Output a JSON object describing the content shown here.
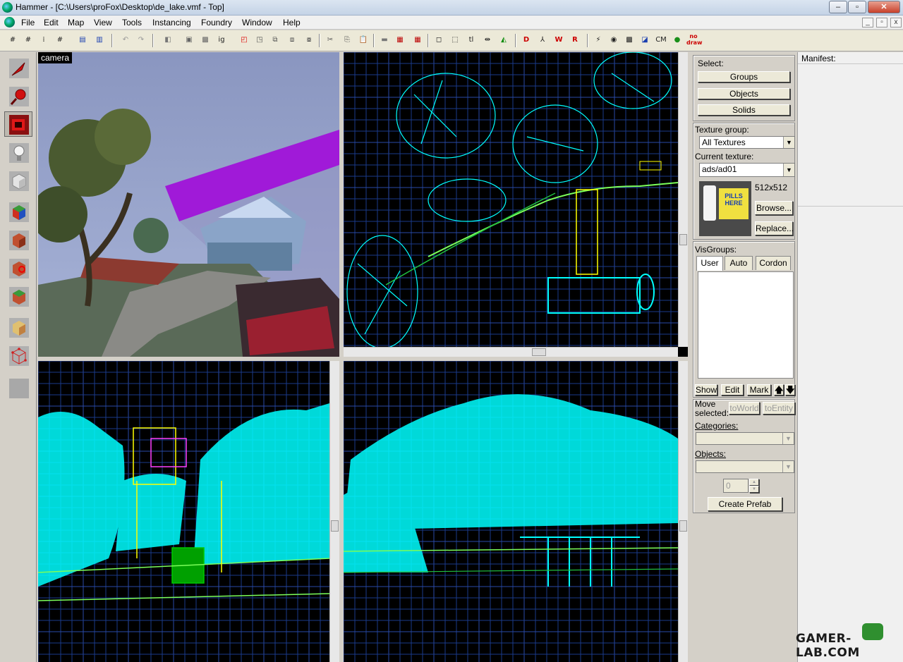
{
  "window": {
    "title": "Hammer - [C:\\Users\\proFox\\Desktop\\de_lake.vmf - Top]",
    "controls": [
      "–",
      "▫",
      "✕"
    ],
    "mdi_controls": [
      "_",
      "▫",
      "x"
    ]
  },
  "menu": [
    "File",
    "Edit",
    "Map",
    "View",
    "Tools",
    "Instancing",
    "Foundry",
    "Window",
    "Help"
  ],
  "toolbar": {
    "text_buttons": [
      "ig",
      "tl",
      "CM",
      "no draw"
    ]
  },
  "left_tools": [
    {
      "name": "selection-tool",
      "icon": "arrow-icon"
    },
    {
      "name": "magnify-tool",
      "icon": "magnify-icon"
    },
    {
      "name": "camera-tool",
      "icon": "camera-icon",
      "active": true
    },
    {
      "name": "entity-tool",
      "icon": "lightbulb-icon"
    },
    {
      "name": "block-tool",
      "icon": "block-icon"
    },
    {
      "name": "texture-application-tool",
      "icon": "texture-icon"
    },
    {
      "name": "apply-current-texture-tool",
      "icon": "apply-texture-icon"
    },
    {
      "name": "decal-tool",
      "icon": "decal-icon"
    },
    {
      "name": "overlay-tool",
      "icon": "overlay-icon"
    },
    {
      "name": "clipping-tool",
      "icon": "clip-icon"
    },
    {
      "name": "vertex-tool",
      "icon": "vertex-icon"
    },
    {
      "name": "path-tool",
      "icon": "blank-icon"
    }
  ],
  "viewports": {
    "camera_label": "camera"
  },
  "panel": {
    "select_label": "Select:",
    "select_buttons": [
      "Groups",
      "Objects",
      "Solids"
    ],
    "texture_group_label": "Texture group:",
    "texture_group_value": "All Textures",
    "current_texture_label": "Current texture:",
    "current_texture_value": "ads/ad01",
    "texture_size": "512x512",
    "texture_preview_text": "PILLS HERE",
    "browse_label": "Browse...",
    "replace_label": "Replace...",
    "visgroups_label": "VisGroups:",
    "visgroup_tabs": [
      "User",
      "Auto",
      "Cordon"
    ],
    "visgroup_actions": [
      "Show",
      "Edit",
      "Mark"
    ],
    "up_arrow": "🡅",
    "down_arrow": "🡇",
    "move_selected_label": "Move\nselected:",
    "to_world_label": "toWorld",
    "to_entity_label": "toEntity",
    "categories_label": "Categories:",
    "objects_label": "Objects:",
    "count_value": "0",
    "create_prefab_label": "Create Prefab"
  },
  "manifest_label": "Manifest:",
  "watermark": "GAMER-LAB.COM",
  "colors": {
    "wire_cyan": "#00ffff",
    "wire_green": "#00c800",
    "wire_yellow": "#ffff00",
    "grid_blue": "#1a3a8a",
    "panel_gray": "#d4d0c8"
  }
}
